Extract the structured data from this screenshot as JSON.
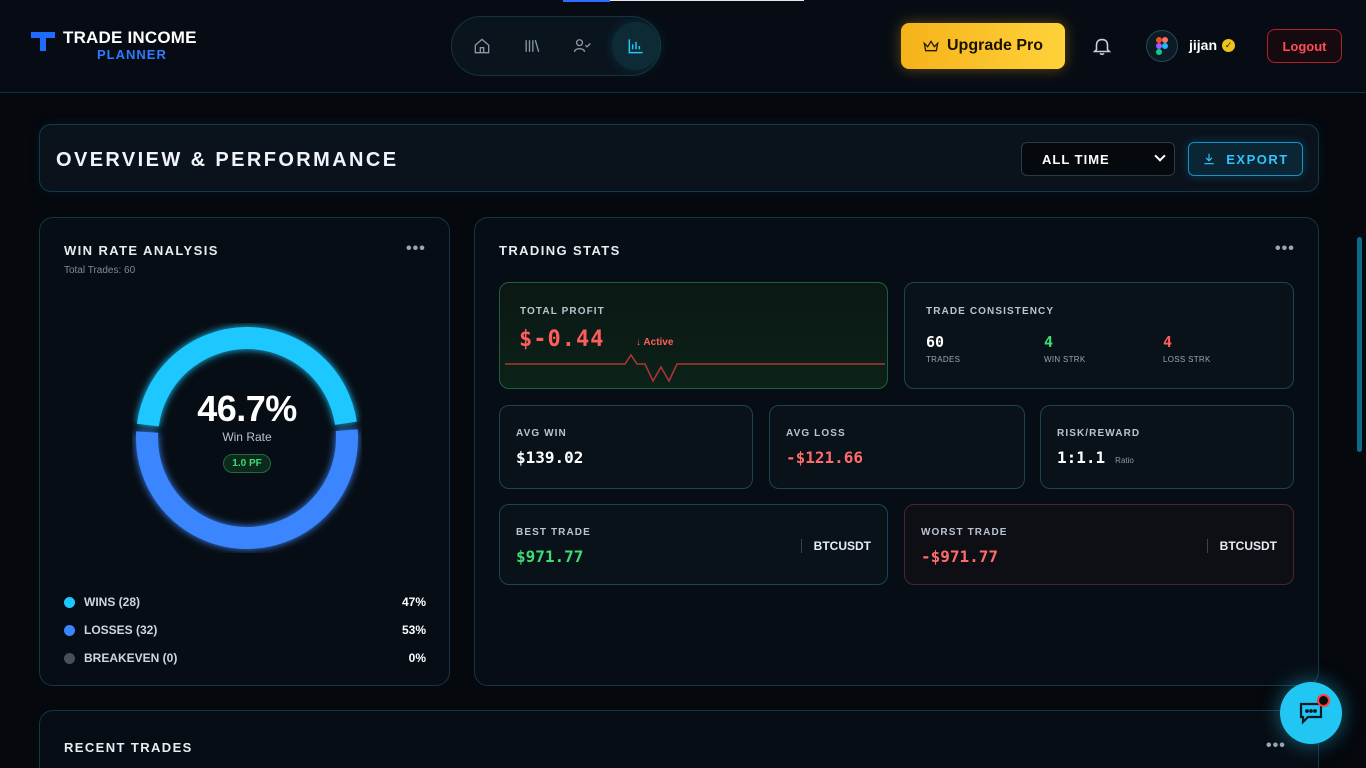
{
  "brand": {
    "title": "TRADE INCOME",
    "subtitle": "PLANNER"
  },
  "nav": {
    "items": [
      {
        "name": "home",
        "icon": "home-icon"
      },
      {
        "name": "library",
        "icon": "library-icon"
      },
      {
        "name": "users",
        "icon": "user-check-icon"
      },
      {
        "name": "analytics",
        "icon": "bar-chart-icon",
        "active": true
      }
    ]
  },
  "header": {
    "upgrade_label": "Upgrade Pro",
    "username": "jijan",
    "logout_label": "Logout"
  },
  "overview": {
    "title": "OVERVIEW & PERFORMANCE",
    "range_value": "ALL TIME",
    "export_label": "EXPORT"
  },
  "winrate": {
    "title": "WIN RATE ANALYSIS",
    "total_trades": "Total Trades: 60",
    "value": "46.7%",
    "label": "Win Rate",
    "pf_badge": "1.0 PF",
    "win_fraction": 0.467,
    "legend": [
      {
        "label": "WINS (28)",
        "pct": "47%",
        "color": "#1cc8ff"
      },
      {
        "label": "LOSSES (32)",
        "pct": "53%",
        "color": "#3a86ff"
      },
      {
        "label": "BREAKEVEN (0)",
        "pct": "0%",
        "color": "#4a4f57"
      }
    ]
  },
  "stats": {
    "title": "TRADING STATS",
    "total_profit": {
      "label": "TOTAL PROFIT",
      "value": "$-0.44",
      "status": "↓ Active"
    },
    "consistency": {
      "label": "TRADE CONSISTENCY",
      "trades": {
        "value": "60",
        "label": "TRADES"
      },
      "win_streak": {
        "value": "4",
        "label": "WIN STRK"
      },
      "loss_streak": {
        "value": "4",
        "label": "LOSS STRK"
      }
    },
    "avg_win": {
      "label": "AVG WIN",
      "value": "$139.02"
    },
    "avg_loss": {
      "label": "AVG LOSS",
      "value": "-$121.66"
    },
    "risk_reward": {
      "label": "RISK/REWARD",
      "value": "1:1.1",
      "sub": "Ratio"
    },
    "best_trade": {
      "label": "BEST TRADE",
      "value": "$971.77",
      "symbol": "BTCUSDT"
    },
    "worst_trade": {
      "label": "WORST TRADE",
      "value": "-$971.77",
      "symbol": "BTCUSDT"
    }
  },
  "recent": {
    "title": "RECENT TRADES"
  },
  "colors": {
    "accent": "#1cc8ff",
    "positive": "#3fdc74",
    "negative": "#ff5d5d",
    "upgrade": "#f6b21a"
  }
}
